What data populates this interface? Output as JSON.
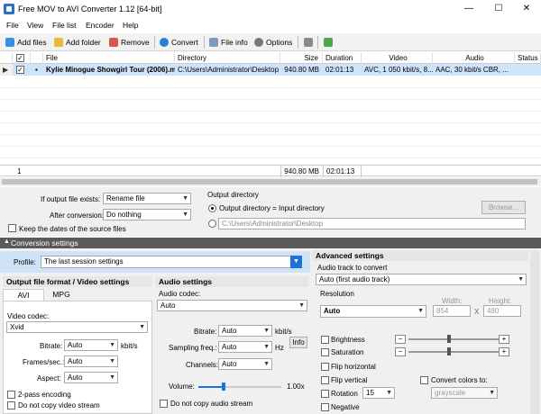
{
  "window": {
    "title": "Free MOV to AVI Converter 1.12  [64-bit]",
    "minimize_glyph": "—",
    "maximize_glyph": "☐",
    "close_glyph": "✕"
  },
  "menu": [
    "File",
    "View",
    "File list",
    "Encoder",
    "Help"
  ],
  "toolbar": {
    "add_files": "Add files",
    "add_folder": "Add folder",
    "remove": "Remove",
    "convert": "Convert",
    "file_info": "File info",
    "options": "Options"
  },
  "grid": {
    "headers": [
      "File",
      "Directory",
      "Size",
      "Duration",
      "Video",
      "Audio",
      "Status"
    ],
    "rows": [
      {
        "file": "Kylie Minogue Showgirl Tour (2006).mov",
        "directory": "C:\\Users\\Administrator\\Desktop",
        "size": "940.80 MB",
        "duration": "02:01:13",
        "video": "AVC, 1 050 kbit/s, 8...",
        "audio": "AAC, 30 kbit/s CBR, ...",
        "status": ""
      }
    ],
    "footer": {
      "count": "1",
      "size": "940.80 MB",
      "duration": "02:01:13"
    }
  },
  "options": {
    "if_exists_label": "If output file exists:",
    "if_exists_value": "Rename file",
    "after_conversion_label": "After conversion:",
    "after_conversion_value": "Do nothing",
    "keep_dates_label": "Keep the dates of the source files",
    "output_directory_label": "Output directory",
    "output_eq_input": "Output directory = Input directory",
    "custom_dir": "C:\\Users\\Administrator\\Desktop",
    "browse": "Browse..."
  },
  "conversion": {
    "section_title": "Conversion settings",
    "profile_label": "Profile:",
    "profile_value": "The last session settings"
  },
  "video": {
    "section_title": "Output file format / Video settings",
    "tabs": [
      "AVI",
      "MPG"
    ],
    "codec_label": "Video codec:",
    "codec_value": "Xvid",
    "bitrate_label": "Bitrate:",
    "bitrate_value": "Auto",
    "bitrate_unit": "kbit/s",
    "fps_label": "Frames/sec.:",
    "fps_value": "Auto",
    "aspect_label": "Aspect:",
    "aspect_value": "Auto",
    "two_pass": "2-pass encoding",
    "no_copy_video": "Do not copy video stream"
  },
  "audio": {
    "section_title": "Audio settings",
    "codec_label": "Audio codec:",
    "codec_value": "Auto",
    "bitrate_label": "Bitrate:",
    "bitrate_value": "Auto",
    "bitrate_unit": "kbit/s",
    "freq_label": "Sampling freq.:",
    "freq_value": "Auto",
    "freq_unit": "Hz",
    "info": "Info",
    "channels_label": "Channels:",
    "channels_value": "Auto",
    "volume_label": "Volume:",
    "volume_value": "1.00x",
    "volume_level": 0.3,
    "no_copy_audio": "Do not copy audio stream"
  },
  "advanced": {
    "section_title": "Advanced settings",
    "track_label": "Audio track to convert",
    "track_value": "Auto (first audio track)",
    "resolution_label": "Resolution",
    "resolution_value": "Auto",
    "width_label": "Width:",
    "width_value": "854",
    "x": "X",
    "height_label": "Height:",
    "height_value": "480",
    "brightness": "Brightness",
    "saturation": "Saturation",
    "flip_h": "Flip horizontal",
    "flip_v": "Flip vertical",
    "rotation": "Rotation",
    "rotation_value": "15",
    "negative": "Negative",
    "convert_colors": "Convert colors to:",
    "convert_colors_value": "grayscale",
    "brightness_level": 0.45,
    "saturation_level": 0.45
  },
  "colors": {
    "accent": "#1e73d6",
    "selected_row": "#cde4fb",
    "section_bar": "#5a5a5a"
  }
}
